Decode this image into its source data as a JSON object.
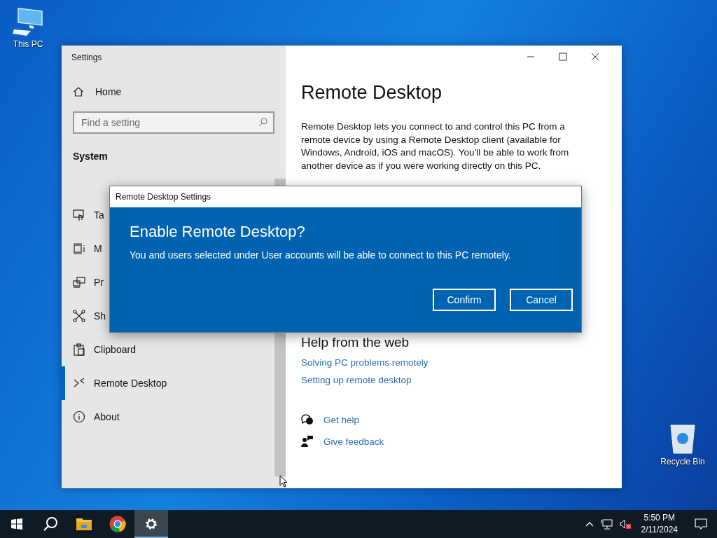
{
  "desktop_icons": [
    {
      "label": "This PC",
      "kind": "pc"
    },
    {
      "label": "Recycle Bin",
      "kind": "bin"
    }
  ],
  "settings_window": {
    "title": "Settings",
    "sidebar": {
      "home": "Home",
      "search": {
        "placeholder": "Find a setting"
      },
      "section": "System",
      "items": [
        {
          "label": "Ta",
          "kind": "tablet",
          "selected": false
        },
        {
          "label": "M",
          "kind": "multitask",
          "selected": false
        },
        {
          "label": "Pr",
          "kind": "project",
          "selected": false
        },
        {
          "label": "Sh",
          "kind": "share",
          "selected": false
        },
        {
          "label": "Clipboard",
          "kind": "clipboard",
          "selected": false
        },
        {
          "label": "Remote Desktop",
          "kind": "remote",
          "selected": true
        },
        {
          "label": "About",
          "kind": "about",
          "selected": false
        }
      ]
    },
    "content": {
      "title": "Remote Desktop",
      "description": "Remote Desktop lets you connect to and control this PC from a remote device by using a Remote Desktop client (available for Windows, Android, iOS and macOS). You'll be able to work from another device as if you were working directly on this PC.",
      "help_heading": "Help from the web",
      "links": [
        "Solving PC problems remotely",
        "Setting up remote desktop"
      ],
      "actions": [
        {
          "label": "Get help",
          "kind": "help"
        },
        {
          "label": "Give feedback",
          "kind": "feedback"
        }
      ]
    }
  },
  "dialog": {
    "title": "Remote Desktop Settings",
    "heading": "Enable Remote Desktop?",
    "message": "You and users selected under User accounts will be able to connect to this PC remotely.",
    "buttons": [
      "Confirm",
      "Cancel"
    ]
  },
  "taskbar": {
    "apps": [
      {
        "kind": "start",
        "selected": false
      },
      {
        "kind": "search",
        "selected": false
      },
      {
        "kind": "folder",
        "selected": false
      },
      {
        "kind": "browser",
        "selected": false
      },
      {
        "kind": "settings",
        "selected": true
      }
    ],
    "clock": {
      "time": "5:50 PM",
      "date": "2/11/2024"
    }
  }
}
